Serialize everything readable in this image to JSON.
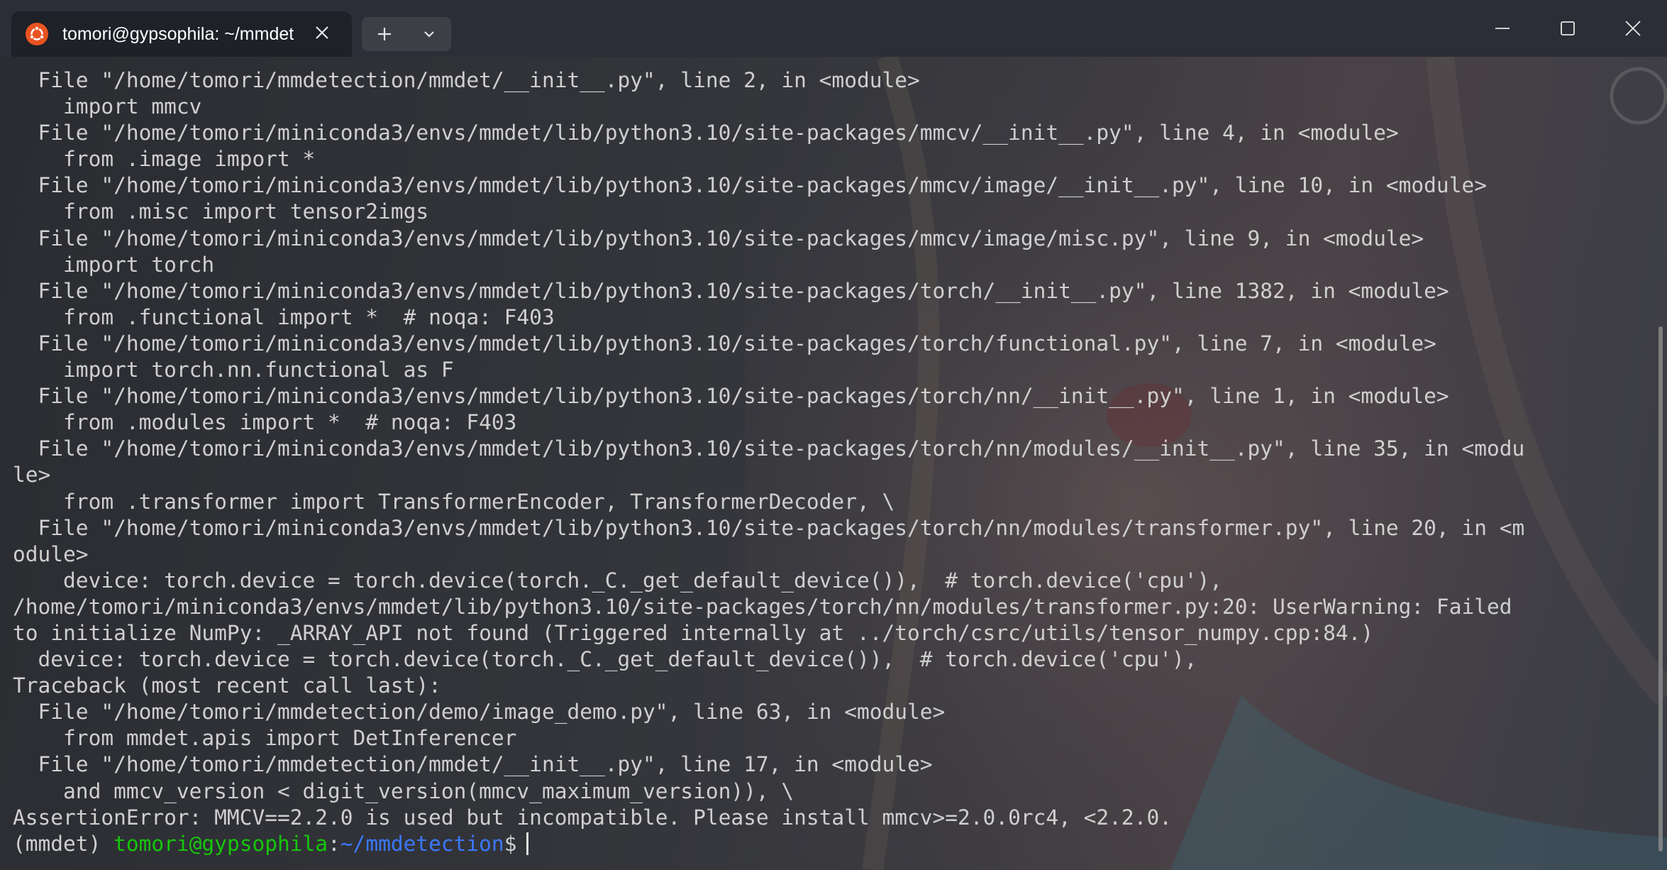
{
  "window": {
    "tab_title": "tomori@gypsophila: ~/mmdet",
    "colors": {
      "titlebar": "#2b2e36",
      "tab_active": "#1e2127",
      "text": "#cfcfcf",
      "prompt_user": "#16c60c",
      "prompt_path": "#3b78ff"
    },
    "icons": {
      "tab_icon": "ubuntu-icon",
      "tab_close": "close-icon",
      "new_tab": "plus-icon",
      "dropdown": "chevron-down-icon",
      "minimize": "minimize-icon",
      "maximize": "maximize-icon",
      "close": "close-icon"
    }
  },
  "terminal": {
    "lines": [
      "  File \"/home/tomori/mmdetection/mmdet/__init__.py\", line 2, in <module>",
      "    import mmcv",
      "  File \"/home/tomori/miniconda3/envs/mmdet/lib/python3.10/site-packages/mmcv/__init__.py\", line 4, in <module>",
      "    from .image import *",
      "  File \"/home/tomori/miniconda3/envs/mmdet/lib/python3.10/site-packages/mmcv/image/__init__.py\", line 10, in <module>",
      "    from .misc import tensor2imgs",
      "  File \"/home/tomori/miniconda3/envs/mmdet/lib/python3.10/site-packages/mmcv/image/misc.py\", line 9, in <module>",
      "    import torch",
      "  File \"/home/tomori/miniconda3/envs/mmdet/lib/python3.10/site-packages/torch/__init__.py\", line 1382, in <module>",
      "    from .functional import *  # noqa: F403",
      "  File \"/home/tomori/miniconda3/envs/mmdet/lib/python3.10/site-packages/torch/functional.py\", line 7, in <module>",
      "    import torch.nn.functional as F",
      "  File \"/home/tomori/miniconda3/envs/mmdet/lib/python3.10/site-packages/torch/nn/__init__.py\", line 1, in <module>",
      "    from .modules import *  # noqa: F403",
      "  File \"/home/tomori/miniconda3/envs/mmdet/lib/python3.10/site-packages/torch/nn/modules/__init__.py\", line 35, in <modu",
      "le>",
      "    from .transformer import TransformerEncoder, TransformerDecoder, \\",
      "  File \"/home/tomori/miniconda3/envs/mmdet/lib/python3.10/site-packages/torch/nn/modules/transformer.py\", line 20, in <m",
      "odule>",
      "    device: torch.device = torch.device(torch._C._get_default_device()),  # torch.device('cpu'),",
      "/home/tomori/miniconda3/envs/mmdet/lib/python3.10/site-packages/torch/nn/modules/transformer.py:20: UserWarning: Failed",
      "to initialize NumPy: _ARRAY_API not found (Triggered internally at ../torch/csrc/utils/tensor_numpy.cpp:84.)",
      "  device: torch.device = torch.device(torch._C._get_default_device()),  # torch.device('cpu'),",
      "Traceback (most recent call last):",
      "  File \"/home/tomori/mmdetection/demo/image_demo.py\", line 63, in <module>",
      "    from mmdet.apis import DetInferencer",
      "  File \"/home/tomori/mmdetection/mmdet/__init__.py\", line 17, in <module>",
      "    and mmcv_version < digit_version(mmcv_maximum_version)), \\",
      "AssertionError: MMCV==2.2.0 is used but incompatible. Please install mmcv>=2.0.0rc4, <2.2.0."
    ],
    "prompt": {
      "env": "(mmdet) ",
      "user_host": "tomori@gypsophila",
      "separator": ":",
      "path": "~/mmdetection",
      "symbol": "$"
    }
  }
}
